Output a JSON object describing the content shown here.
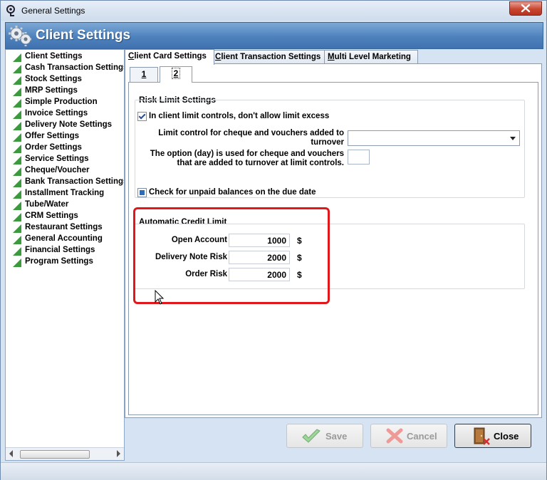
{
  "window": {
    "title": "General Settings"
  },
  "header": {
    "title": "Client Settings"
  },
  "sidebar": {
    "items": [
      {
        "label": "Client Settings"
      },
      {
        "label": "Cash Transaction Settings"
      },
      {
        "label": "Stock Settings"
      },
      {
        "label": "MRP Settings"
      },
      {
        "label": "Simple Production"
      },
      {
        "label": "Invoice Settings"
      },
      {
        "label": "Delivery Note Settings"
      },
      {
        "label": "Offer Settings"
      },
      {
        "label": "Order Settings"
      },
      {
        "label": "Service Settings"
      },
      {
        "label": "Cheque/Voucher"
      },
      {
        "label": "Bank Transaction Settings"
      },
      {
        "label": "Installment Tracking"
      },
      {
        "label": "Tube/Water"
      },
      {
        "label": "CRM Settings"
      },
      {
        "label": "Restaurant Settings"
      },
      {
        "label": "General Accounting"
      },
      {
        "label": "Financial Settings"
      },
      {
        "label": "Program Settings"
      }
    ]
  },
  "tabs": {
    "card": {
      "first": "C",
      "rest": "lient Card Settings"
    },
    "transaction": {
      "first": "C",
      "rest": "lient Transaction Settings"
    },
    "mlm": {
      "first": "M",
      "rest": "ulti Level Marketing"
    }
  },
  "subtabs": {
    "one": "1",
    "two": "2"
  },
  "risk": {
    "title": "Risk Limit Settings",
    "no_excess": "In client limit controls, don't allow limit excess",
    "cheque_label_1": "Limit control for cheque and vouchers added to",
    "cheque_label_2": "turnover",
    "cheque_value": "",
    "day_label_1": "The option (day) is used for cheque and vouchers",
    "day_label_2": "that are added to turnover at limit controls.",
    "day_value": "",
    "unpaid": "Check for unpaid balances on the due date"
  },
  "credit": {
    "title": "Automatic Credit Limit",
    "open_account_label": "Open Account",
    "open_account_value": "1000",
    "delivery_label": "Delivery Note Risk",
    "delivery_value": "2000",
    "order_label": "Order Risk",
    "order_value": "2000",
    "currency": "$"
  },
  "buttons": {
    "save": "Save",
    "cancel": "Cancel",
    "close": "Close"
  },
  "colors": {
    "accent": "#4e82bd",
    "highlight": "#e0181b",
    "nav_icon": "#3a9a3c"
  }
}
